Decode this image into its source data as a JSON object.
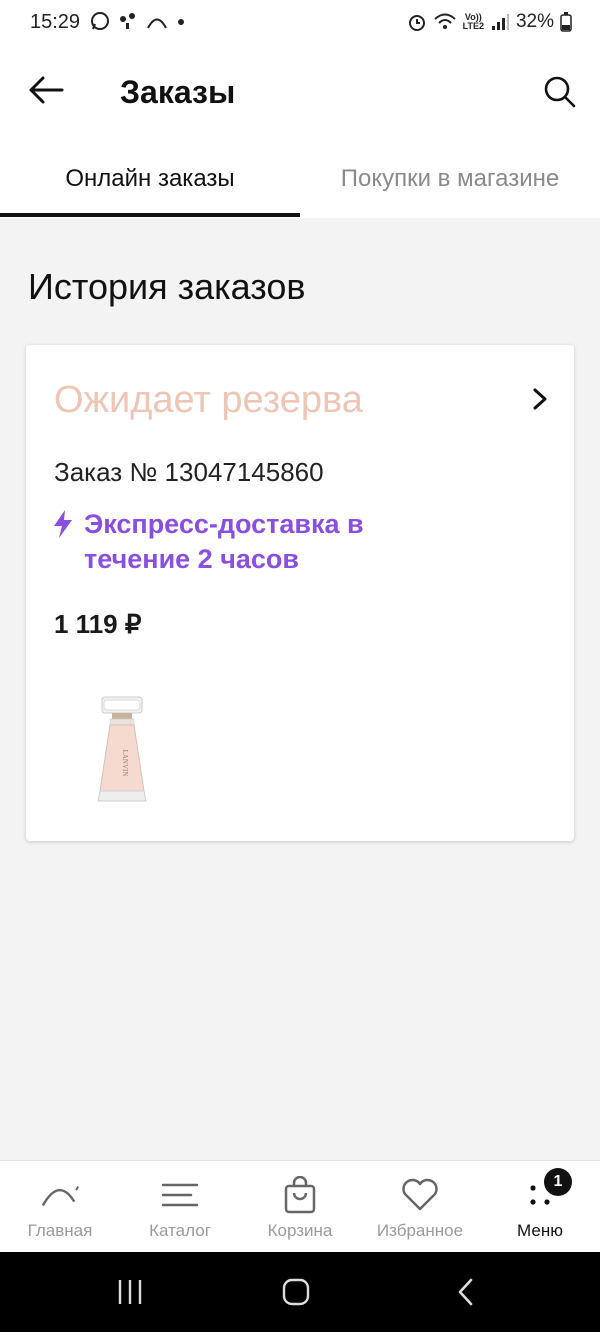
{
  "status_bar": {
    "time": "15:29",
    "battery": "32%",
    "network": [
      "Vo))",
      "LTE2"
    ]
  },
  "app_bar": {
    "title": "Заказы",
    "back_icon": "arrow-left-icon",
    "search_icon": "search-icon"
  },
  "tabs": [
    {
      "label": "Онлайн заказы",
      "active": true
    },
    {
      "label": "Покупки в магазине",
      "active": false
    }
  ],
  "section_title": "История заказов",
  "order": {
    "status": "Ожидает резерва",
    "number": "Заказ № 13047145860",
    "delivery": "Экспресс-доставка в течение 2 часов",
    "price": "1 119 ₽",
    "product_image": "lanvin-perfume-bottle",
    "brand_on_bottle": "LANVIN"
  },
  "bottom_nav": [
    {
      "label": "Главная",
      "icon": "home-arc-icon",
      "active": false
    },
    {
      "label": "Каталог",
      "icon": "catalog-lines-icon",
      "active": false
    },
    {
      "label": "Корзина",
      "icon": "bag-icon",
      "active": false
    },
    {
      "label": "Избранное",
      "icon": "heart-icon",
      "active": false
    },
    {
      "label": "Меню",
      "icon": "menu-dots-icon",
      "active": true,
      "badge": "1"
    }
  ],
  "colors": {
    "status_pending": "#efc5b5",
    "express_purple": "#8a4fe0",
    "background": "#f3f3f3"
  }
}
